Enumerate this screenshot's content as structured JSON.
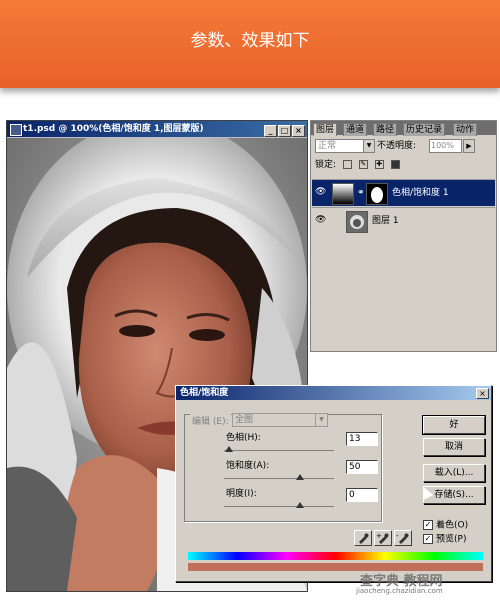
{
  "banner": {
    "title": "参数、效果如下"
  },
  "document": {
    "title": "t1.psd @ 100%(色相/饱和度 1,图层蒙版)",
    "window_buttons": [
      "_",
      "□",
      "×"
    ]
  },
  "layers_panel": {
    "tabs": [
      "图层",
      "通道",
      "路径",
      "历史记录",
      "动作"
    ],
    "blend_mode": "正常",
    "opacity_label": "不透明度:",
    "opacity_value": "100%",
    "lock_label": "锁定:",
    "layers": [
      {
        "name": "色相/饱和度 1",
        "selected": true,
        "visible": true
      },
      {
        "name": "图层 1",
        "selected": false,
        "visible": true
      }
    ]
  },
  "hue_sat_dialog": {
    "title": "色相/饱和度",
    "edit_label": "编辑",
    "edit_shortcut": "(E):",
    "edit_value": "全图",
    "hue_label": "色相",
    "hue_shortcut": "(H):",
    "hue_value": "13",
    "saturation_label": "饱和度",
    "saturation_shortcut": "(A):",
    "saturation_value": "50",
    "lightness_label": "明度",
    "lightness_shortcut": "(I):",
    "lightness_value": "0",
    "ok_label": "好",
    "cancel_label": "取消",
    "load_label": "载入(L)...",
    "save_label": "存储(S)...",
    "colorize_label": "着色",
    "colorize_shortcut": "(O)",
    "colorize_checked": true,
    "preview_label": "预览",
    "preview_shortcut": "(P)",
    "preview_checked": true
  },
  "watermark": {
    "main": "查字典 教程网",
    "sub": "jiaocheng.chazidian.com"
  },
  "colors": {
    "banner": "#ef6c2f",
    "title_bar": "#0a246a",
    "dialog_bg": "#d4d0c8",
    "tint_bar": "#c0705a"
  }
}
